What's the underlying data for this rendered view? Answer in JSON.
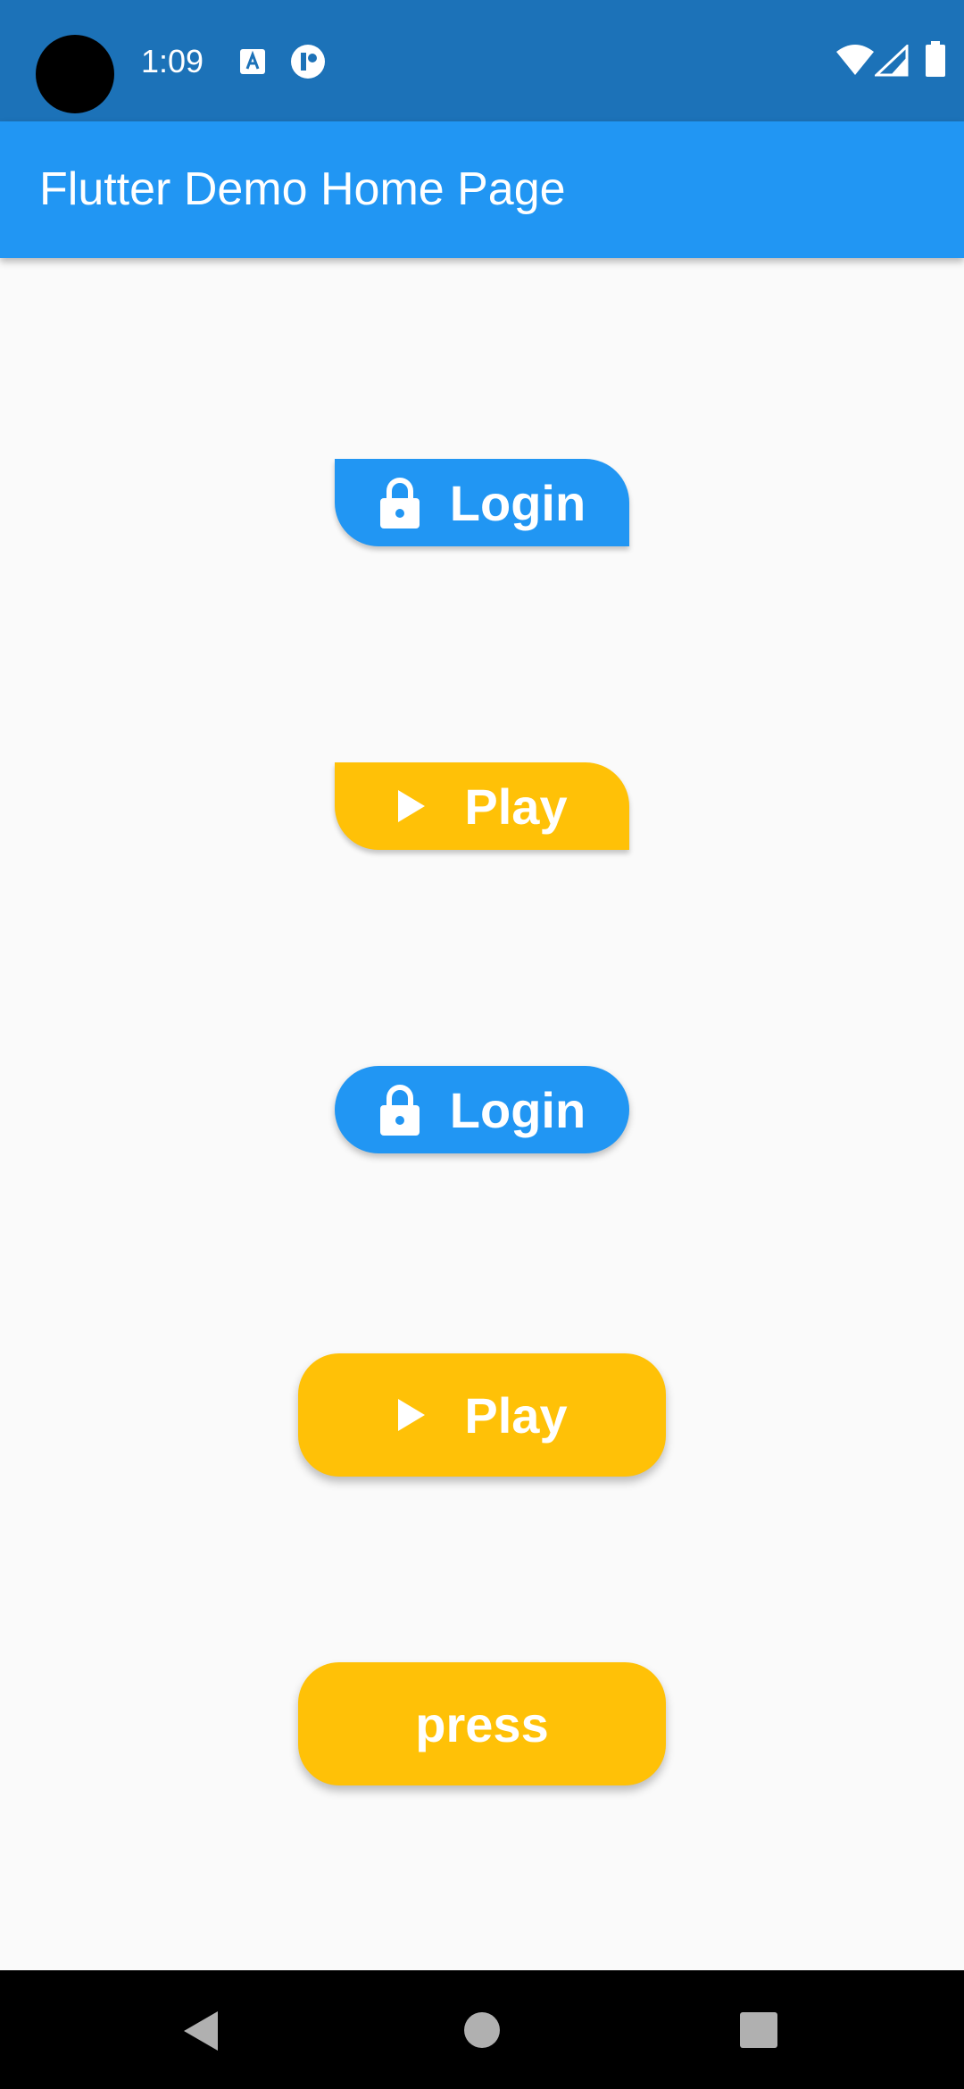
{
  "status_bar": {
    "time": "1:09",
    "icons": [
      "text-a-notification-icon",
      "app-notification-icon",
      "wifi-icon",
      "cellular-signal-icon",
      "battery-icon"
    ]
  },
  "app_bar": {
    "title": "Flutter Demo Home Page",
    "color": "#2196f3"
  },
  "buttons": [
    {
      "label": "Login",
      "icon": "lock-icon",
      "color": "#2196f3",
      "shape": "diagonal-rounded"
    },
    {
      "label": "Play",
      "icon": "play-icon",
      "color": "#ffc107",
      "shape": "diagonal-rounded"
    },
    {
      "label": "Login",
      "icon": "lock-icon",
      "color": "#2196f3",
      "shape": "pill"
    },
    {
      "label": "Play",
      "icon": "play-icon",
      "color": "#ffc107",
      "shape": "pill"
    },
    {
      "label": "press",
      "icon": "",
      "color": "#ffc107",
      "shape": "pill"
    }
  ],
  "nav_bar": {
    "icons": [
      "back-icon",
      "home-icon",
      "recents-icon"
    ]
  }
}
